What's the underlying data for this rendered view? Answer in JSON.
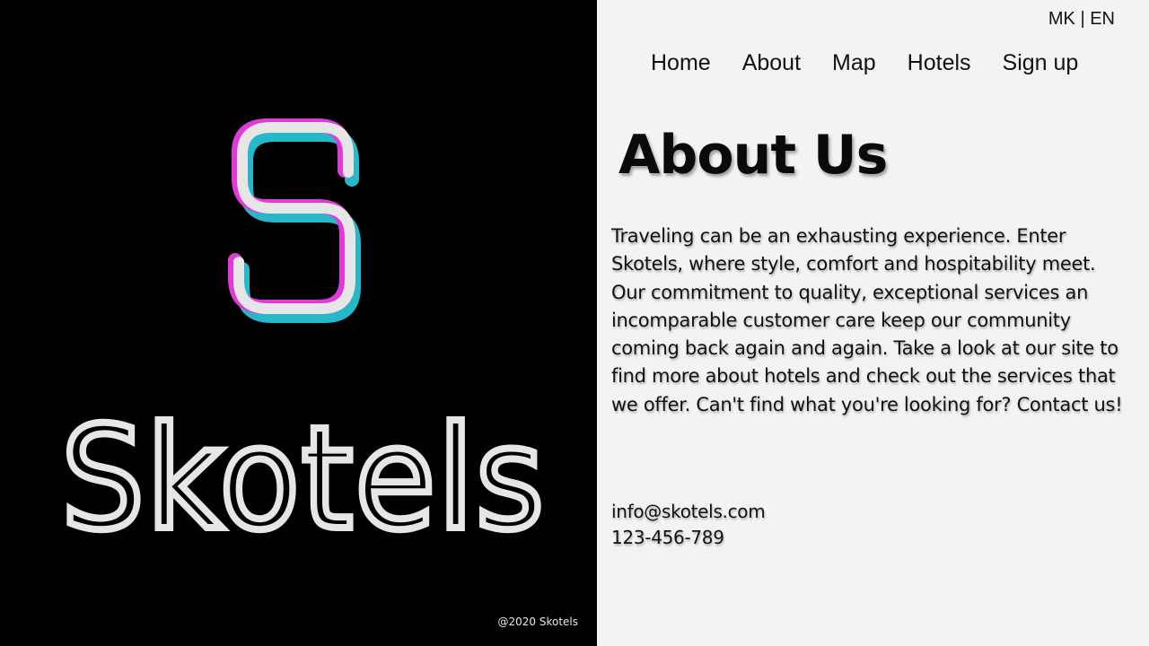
{
  "brand": {
    "name": "Skotels",
    "copyright": "@2020 Skotels",
    "colors": {
      "magenta": "#e03ad8",
      "cyan": "#26b7c9",
      "white": "#e6e6e6",
      "background": "#000000"
    }
  },
  "language_switch": {
    "mk": "MK",
    "separator": " | ",
    "en": "EN"
  },
  "nav": {
    "items": [
      {
        "label": "Home"
      },
      {
        "label": "About"
      },
      {
        "label": "Map"
      },
      {
        "label": "Hotels"
      },
      {
        "label": "Sign up"
      }
    ]
  },
  "main": {
    "title": "About Us",
    "body": "Traveling can be an exhausting experience. Enter Skotels, where style, comfort and hospitability meet. Our commitment to quality, exceptional services an incomparable customer care keep our community coming back again and again. Take a look at our site to find more about hotels and check out  the services that we offer. Can't find what you're looking for? Contact us!"
  },
  "contact": {
    "email": "info@skotels.com",
    "phone": "123-456-789"
  }
}
